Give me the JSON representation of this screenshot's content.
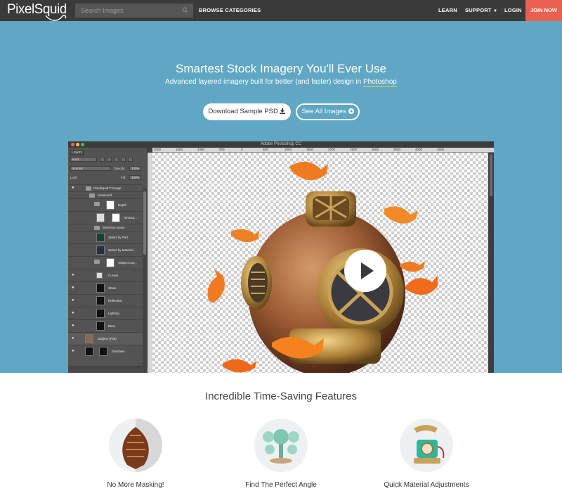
{
  "nav": {
    "logo_text": "PixelSquid",
    "search_placeholder": "Search Images",
    "browse": "BROWSE CATEGORIES",
    "learn": "LEARN",
    "support": "SUPPORT",
    "login": "LOGIN",
    "join": "JOIN NOW"
  },
  "hero": {
    "title": "Smartest Stock Imagery You'll Ever Use",
    "subtitle_pre": "Advanced layered imagery built for better (and faster) design in ",
    "subtitle_link": "Photoshop",
    "btn_download": "Download Sample PSD",
    "btn_see_all": "See All Images"
  },
  "photoshop": {
    "window_title": "Adobe Photoshop CC",
    "panel_tab": "Layers",
    "kind": "Kind",
    "blend_mode": "Normal",
    "opacity_label": "Opacity:",
    "opacity_value": "100%",
    "lock_label": "Lock:",
    "fill_label": "Fill:",
    "fill_value": "100%",
    "ruler_ticks": [
      "2000",
      "1500",
      "1000",
      "500",
      "0",
      "500",
      "1000",
      "1500",
      "2000",
      "2500",
      "3000",
      "3500",
      "4000",
      "4500"
    ],
    "layers": [
      {
        "name": "PixelSquid™ Image"
      },
      {
        "name": "Advanced"
      },
      {
        "name": "Depth"
      },
      {
        "name": "Atmosp..."
      },
      {
        "name": "Selection Areas"
      },
      {
        "name": "Select by Part"
      },
      {
        "name": "Select by Material"
      },
      {
        "name": "Subject Lay..."
      },
      {
        "name": "Curves"
      },
      {
        "name": "Shine"
      },
      {
        "name": "Reflection"
      },
      {
        "name": "Lighting"
      },
      {
        "name": "Base"
      },
      {
        "name": "Subject (Flat)"
      },
      {
        "name": "Shadows"
      }
    ]
  },
  "features": {
    "title": "Incredible Time-Saving Features",
    "items": [
      {
        "label": "No More Masking!"
      },
      {
        "label": "Find The Perfect Angle"
      },
      {
        "label": "Quick Material Adjustments"
      }
    ]
  },
  "colors": {
    "nav_bg": "#3a3a3a",
    "hero_bg": "#5fa7c4",
    "join_bg": "#e9604e",
    "link_underline": "#f0d44a"
  }
}
